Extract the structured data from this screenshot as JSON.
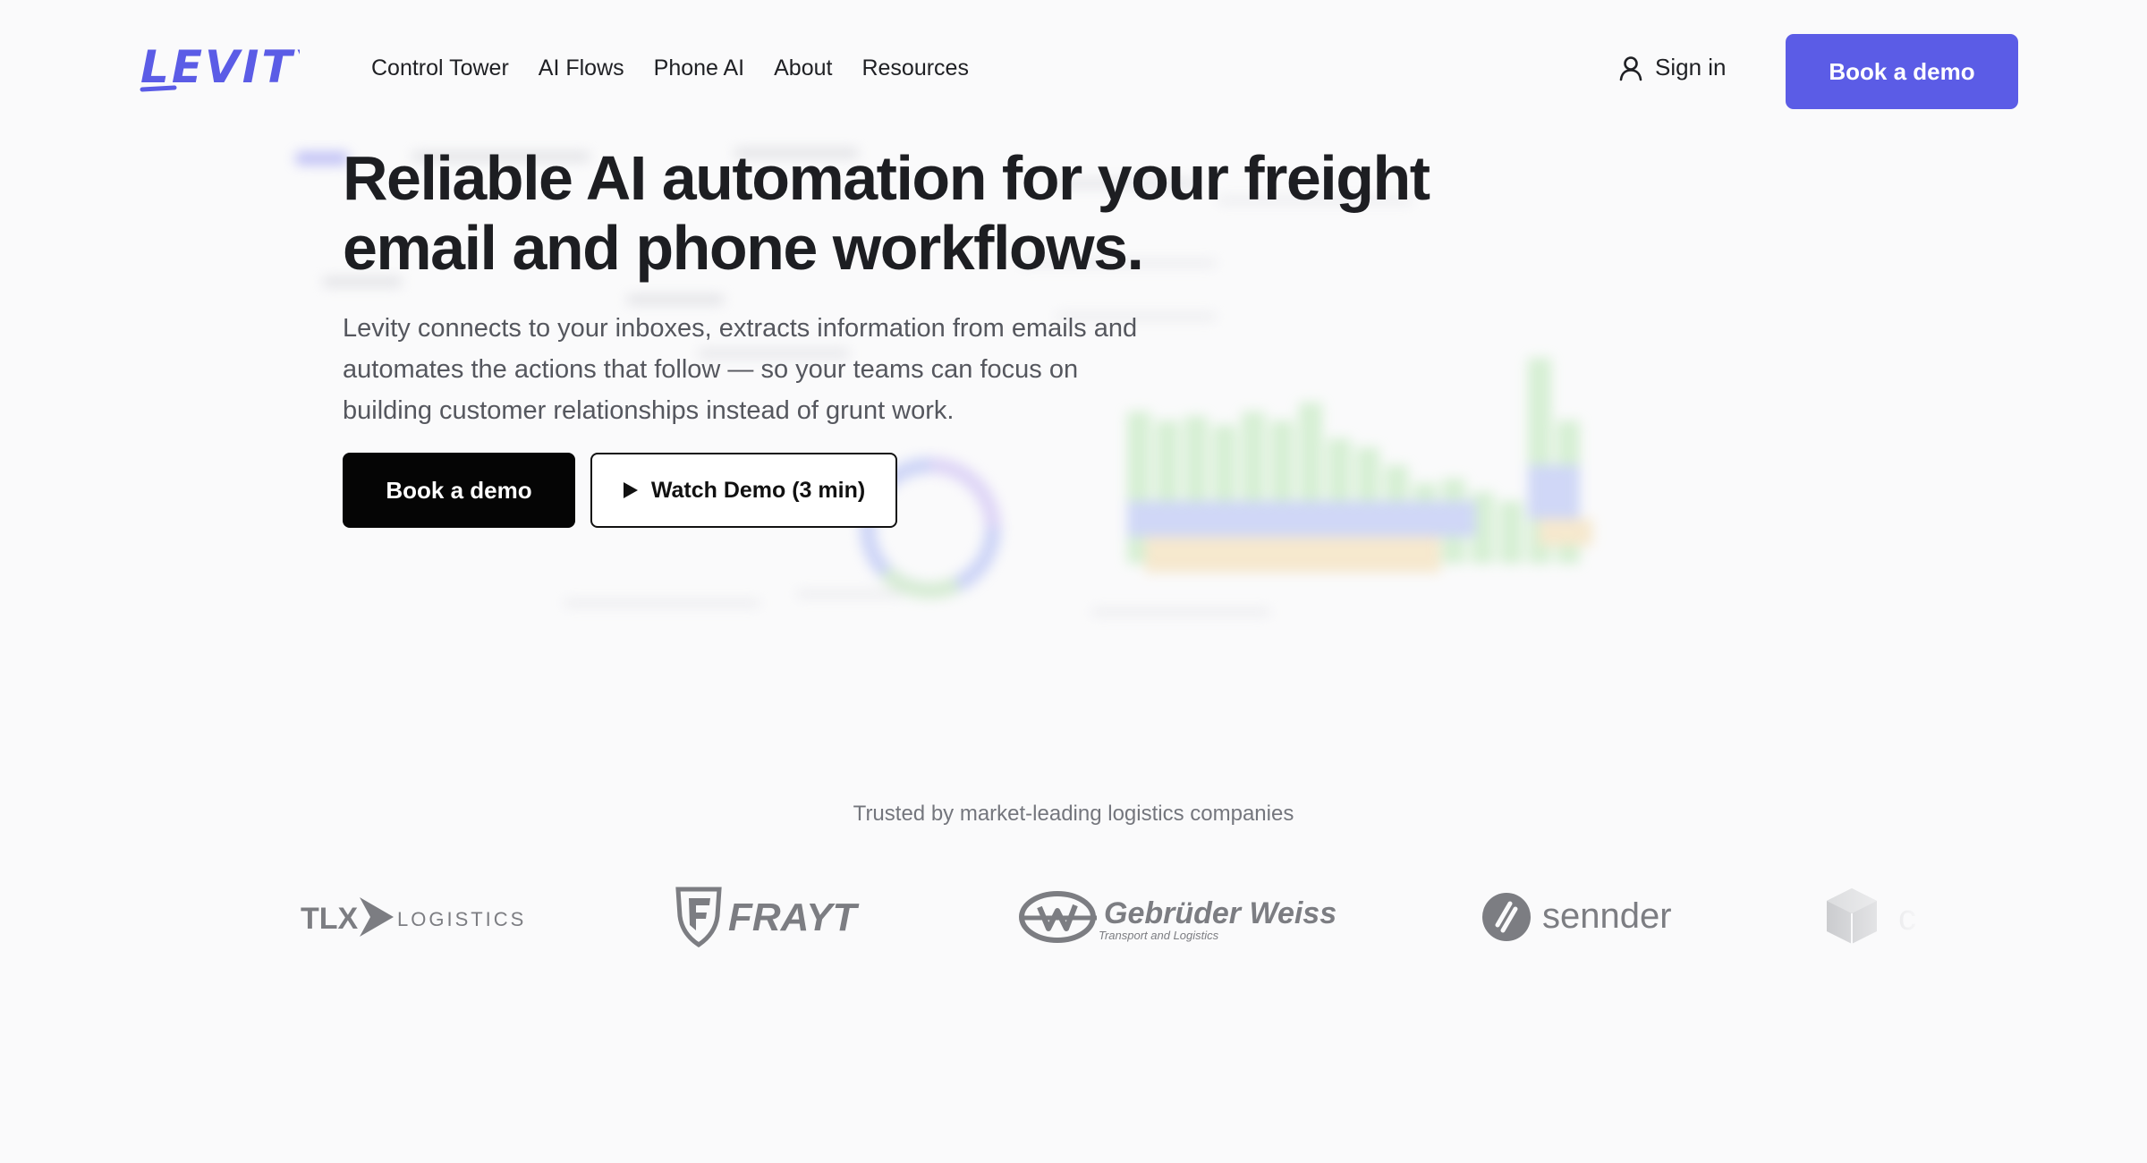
{
  "brand": {
    "name": "LEVITY",
    "accent": "#5b5ce6"
  },
  "nav": {
    "links": [
      "Control Tower",
      "AI Flows",
      "Phone AI",
      "About",
      "Resources"
    ],
    "sign_in": "Sign in",
    "cta": "Book a demo"
  },
  "hero": {
    "title_line1": "Reliable AI automation for your freight",
    "title_line2": "email and phone workflows.",
    "subtitle_line1": "Levity connects to your inboxes, extracts information from emails and",
    "subtitle_line2": "automates the actions that follow — so your teams can focus on",
    "subtitle_line3": "building customer relationships instead of grunt work.",
    "primary_cta": "Book a demo",
    "secondary_cta": "Watch Demo (3 min)"
  },
  "trusted": {
    "heading": "Trusted by market-leading logistics companies",
    "logos": [
      {
        "name": "TLX LOGISTICS",
        "part1": "TLX",
        "part2": "LOGISTICS",
        "icon": "chevron-arrow-icon"
      },
      {
        "name": "FRAYT",
        "text": "FRAYT",
        "icon": "shield-f-icon"
      },
      {
        "name": "Gebrüder Weiss",
        "text": "Gebrüder Weiss",
        "tagline": "Transport and Logistics",
        "icon": "gw-swoosh-icon"
      },
      {
        "name": "sennder",
        "text": "sennder",
        "icon": "sennder-s-icon"
      },
      {
        "name": "partial-logo",
        "text": "c",
        "icon": "cube-icon"
      }
    ]
  }
}
